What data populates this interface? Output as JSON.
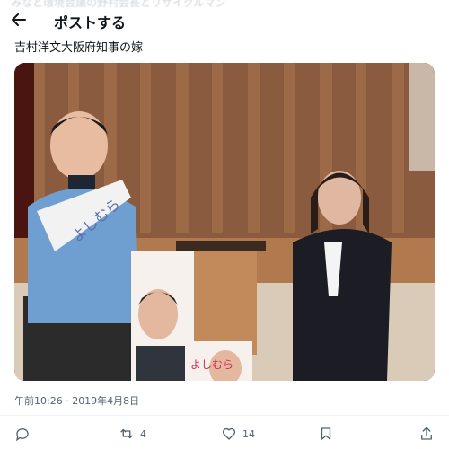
{
  "header": {
    "faded_text": "みなと環境会議の野村会長とリサイクルマン",
    "title": "ポストする"
  },
  "post": {
    "text": "吉村洋文大阪府知事の嫁",
    "timestamp": "午前10:26 · 2019年4月8日",
    "sash_text": "よしむら",
    "poster_text": "よしむら"
  },
  "actions": {
    "reply_count": "",
    "repost_count": "4",
    "like_count": "14"
  },
  "icons": [
    "back-arrow-icon",
    "reply-icon",
    "repost-icon",
    "like-icon",
    "bookmark-icon",
    "share-icon"
  ]
}
